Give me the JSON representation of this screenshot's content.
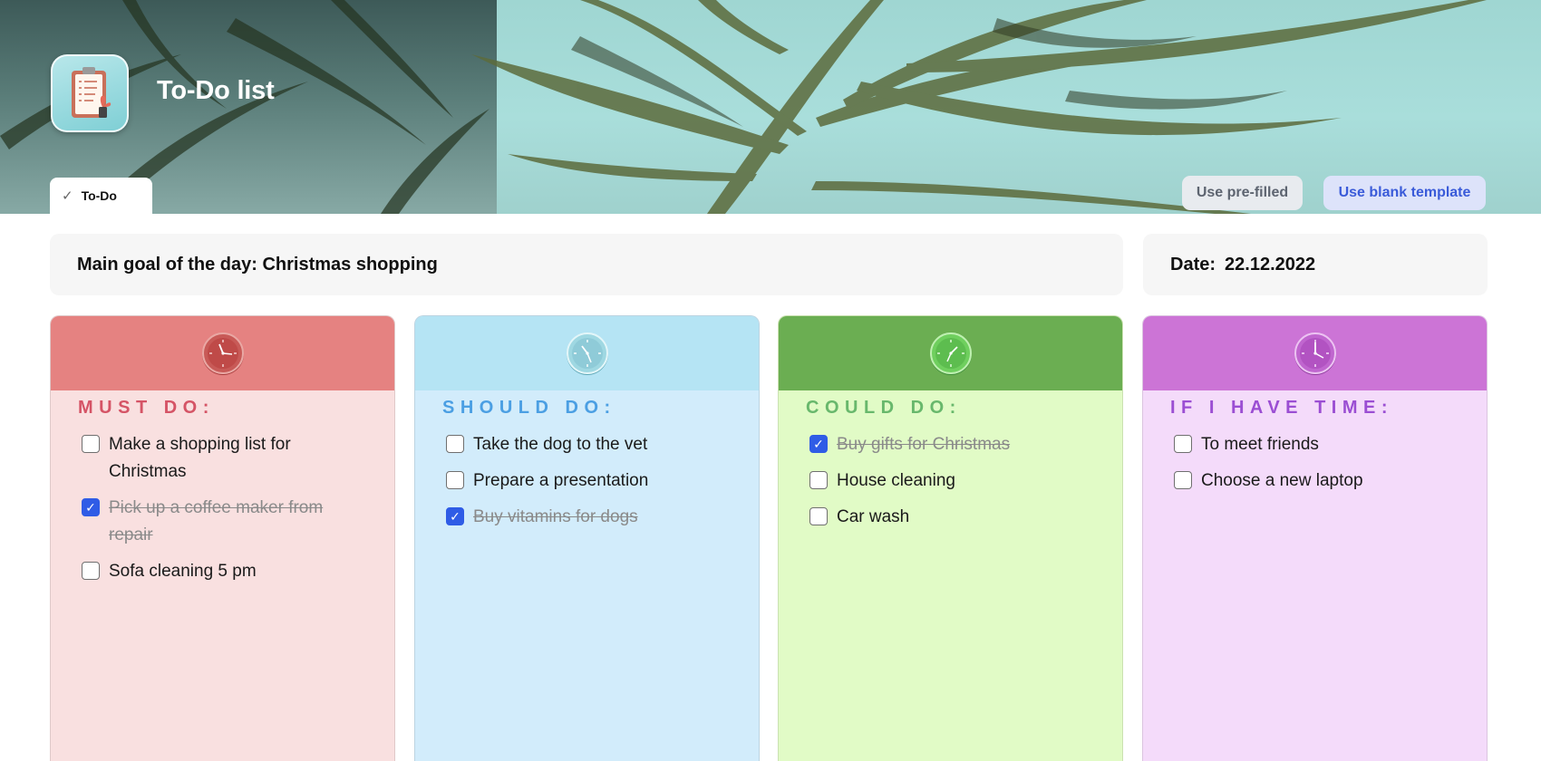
{
  "header": {
    "title": "To-Do list",
    "icon": "clipboard-checklist-icon"
  },
  "tabs": [
    {
      "label": "To-Do",
      "icon": "checkmark-icon",
      "active": true
    }
  ],
  "actions": {
    "prefilled_label": "Use pre-filled",
    "blank_label": "Use blank template"
  },
  "goal": {
    "text": "Main goal of the day: Christmas shopping"
  },
  "date": {
    "label": "Date:",
    "value": "22.12.2022"
  },
  "columns": [
    {
      "title": "MUST DO:",
      "icon": "clock-icon",
      "accent": "#e58281",
      "items": [
        {
          "text": "Make a shopping list for Christmas",
          "checked": false
        },
        {
          "text": "Pick up a coffee maker from repair",
          "checked": true
        },
        {
          "text": "Sofa cleaning 5 pm",
          "checked": false
        }
      ]
    },
    {
      "title": "SHOULD DO:",
      "icon": "clock-icon",
      "accent": "#b5e4f4",
      "items": [
        {
          "text": "Take the dog to the vet",
          "checked": false
        },
        {
          "text": "Prepare a presentation",
          "checked": false
        },
        {
          "text": "Buy vitamins for dogs",
          "checked": true
        }
      ]
    },
    {
      "title": "COULD DO:",
      "icon": "clock-icon",
      "accent": "#6bae52",
      "items": [
        {
          "text": "Buy gifts for Christmas",
          "checked": true
        },
        {
          "text": "House cleaning",
          "checked": false
        },
        {
          "text": "Car wash",
          "checked": false
        }
      ]
    },
    {
      "title": "IF I HAVE TIME:",
      "icon": "clock-icon",
      "accent": "#cc74d6",
      "items": [
        {
          "text": "To meet friends",
          "checked": false
        },
        {
          "text": "Choose a new laptop",
          "checked": false
        }
      ]
    }
  ]
}
